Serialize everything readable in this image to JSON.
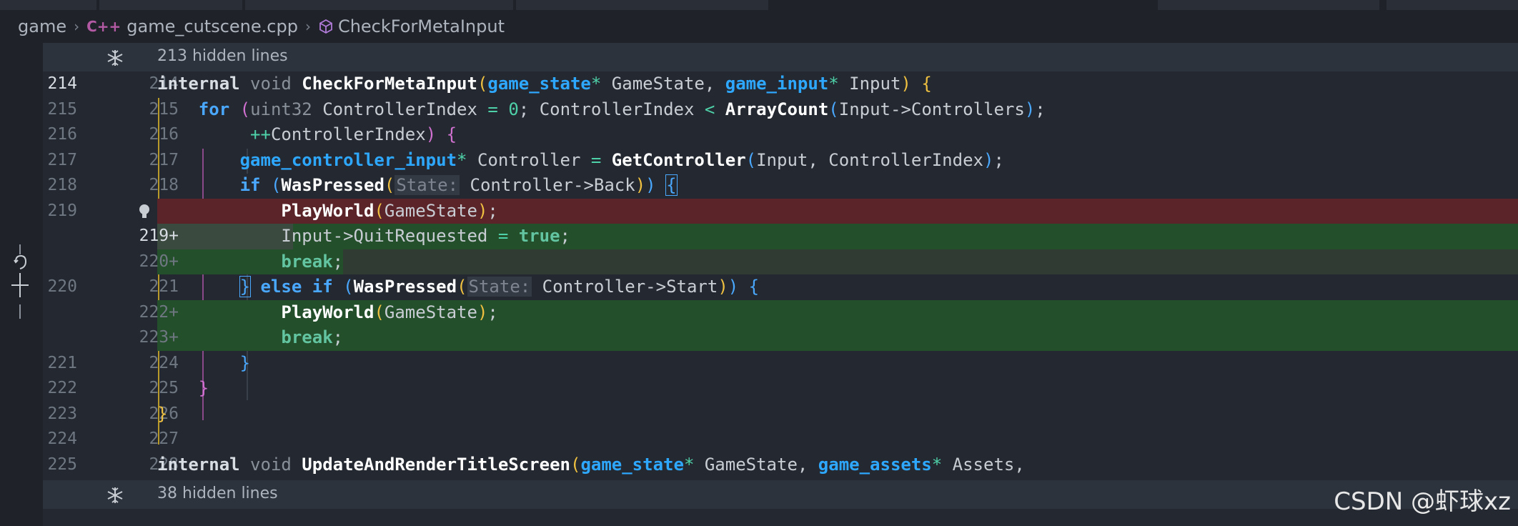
{
  "breadcrumb": {
    "folder": "game",
    "file_icon": "C++",
    "file": "game_cutscene.cpp",
    "symbol": "CheckForMetaInput"
  },
  "folds": {
    "top": "213 hidden lines",
    "bottom": "38 hidden lines"
  },
  "lines": [
    {
      "old": "214",
      "new": "214"
    },
    {
      "old": "215",
      "new": "215"
    },
    {
      "old": "216",
      "new": "216"
    },
    {
      "old": "217",
      "new": "217"
    },
    {
      "old": "218",
      "new": "218"
    },
    {
      "old": "219",
      "new": ""
    },
    {
      "old": "",
      "new": "219+"
    },
    {
      "old": "",
      "new": "220+"
    },
    {
      "old": "220",
      "new": "221"
    },
    {
      "old": "",
      "new": "222+"
    },
    {
      "old": "",
      "new": "223+"
    },
    {
      "old": "221",
      "new": "224"
    },
    {
      "old": "222",
      "new": "225"
    },
    {
      "old": "223",
      "new": "226"
    },
    {
      "old": "224",
      "new": "227"
    },
    {
      "old": "225",
      "new": "228"
    }
  ],
  "tokens": {
    "internal": "internal",
    "void": "void",
    "check_fn": "CheckForMetaInput",
    "paren_open": "(",
    "paren_close": ")",
    "game_state": "game_state",
    "star": "*",
    "game_state_param": "GameState,",
    "game_input": "game_input",
    "input_param": "Input",
    "brace_open": "{",
    "brace_close": "}",
    "for": "for",
    "uint32": "uint32",
    "controller_index": "ControllerIndex",
    "eq": "=",
    "zero": "0",
    "semi_space": ";",
    "lt": "<",
    "array_count": "ArrayCount",
    "input_controllers": "Input->Controllers",
    "close_semi": ");",
    "plusplus": "++",
    "controller_index_inc": "ControllerIndex",
    "game_controller_input": "game_controller_input",
    "controller": "Controller",
    "get_controller": "GetController",
    "get_controller_args": "Input, ControllerIndex",
    "if": "if",
    "was_pressed": "WasPressed",
    "state_hint": "State:",
    "controller_back": "Controller->Back",
    "play_world": "PlayWorld",
    "game_state_arg": "GameState",
    "semi": ";",
    "input_quit": "Input->QuitRequested",
    "true": "true",
    "break": "break",
    "else": "else",
    "controller_start": "Controller->Start",
    "update_fn": "UpdateAndRenderTitleScreen",
    "game_assets": "game_assets",
    "assets_param": "Assets,",
    "gamestate_comma": "GameState,"
  },
  "colors": {
    "deleted_line": "#5a2429",
    "added_line": "#244f2b",
    "keyword": "#4aa8ff",
    "number": "#4ed0a8"
  },
  "watermark": "CSDN @虾球xz"
}
